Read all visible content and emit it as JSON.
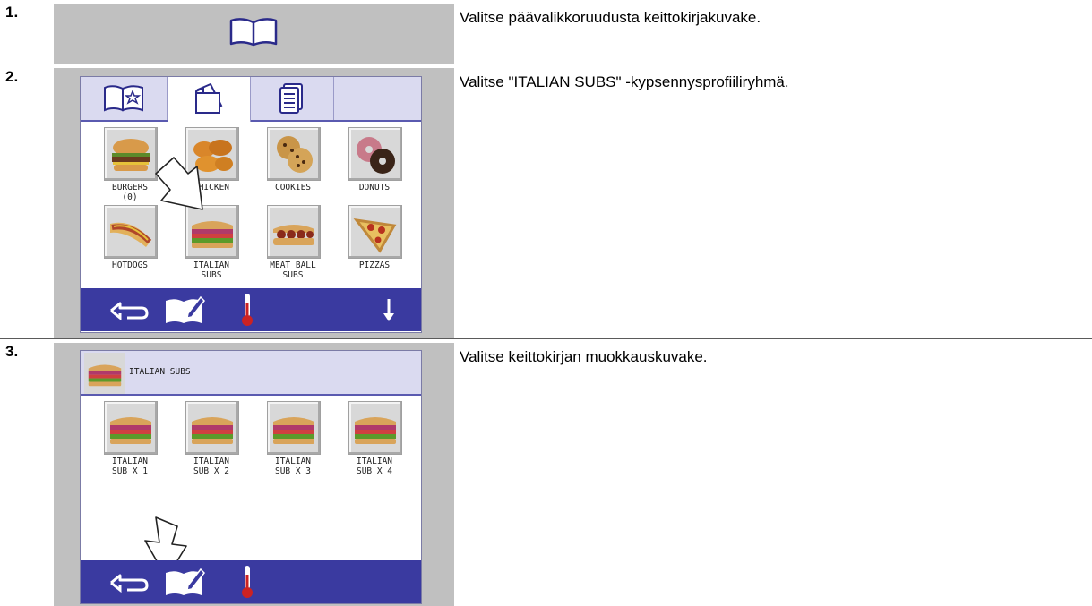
{
  "steps": [
    {
      "number": "1.",
      "text": "Valitse päävalikkoruudusta keittokirjakuvake."
    },
    {
      "number": "2.",
      "text": "Valitse \"ITALIAN SUBS\" -kypsennysprofiiliryhmä."
    },
    {
      "number": "3.",
      "text": "Valitse keittokirjan muokkauskuvake."
    }
  ],
  "screen2": {
    "tabs": [
      "cookbook-favorites-icon",
      "cookbook-pages-icon",
      "recipe-document-icon"
    ],
    "tiles": [
      {
        "label": "BURGERS\n(0)",
        "icon": "burger-icon"
      },
      {
        "label": "CHICKEN",
        "icon": "chicken-icon"
      },
      {
        "label": "COOKIES",
        "icon": "cookies-icon"
      },
      {
        "label": "DONUTS",
        "icon": "donuts-icon"
      },
      {
        "label": "HOTDOGS",
        "icon": "hotdog-icon"
      },
      {
        "label": "ITALIAN\nSUBS",
        "icon": "italian-sub-icon"
      },
      {
        "label": "MEAT BALL\nSUBS",
        "icon": "meatball-sub-icon"
      },
      {
        "label": "PIZZAS",
        "icon": "pizza-icon"
      }
    ],
    "bottom_icons": [
      "back-arrow-icon",
      "cookbook-edit-icon",
      "thermometer-icon",
      "down-arrow-icon"
    ]
  },
  "screen3": {
    "header_title": "ITALIAN SUBS",
    "tiles": [
      {
        "label": "ITALIAN\nSUB X 1"
      },
      {
        "label": "ITALIAN\nSUB X 2"
      },
      {
        "label": "ITALIAN\nSUB X 3"
      },
      {
        "label": "ITALIAN\nSUB X 4"
      }
    ],
    "bottom_icons": [
      "back-arrow-icon",
      "cookbook-edit-icon",
      "thermometer-icon"
    ]
  },
  "colors": {
    "panel_gray": "#c0c0c0",
    "bar_blue": "#3a3aa0",
    "tab_lilac": "#dadaf0",
    "therm_red": "#cc2222"
  }
}
